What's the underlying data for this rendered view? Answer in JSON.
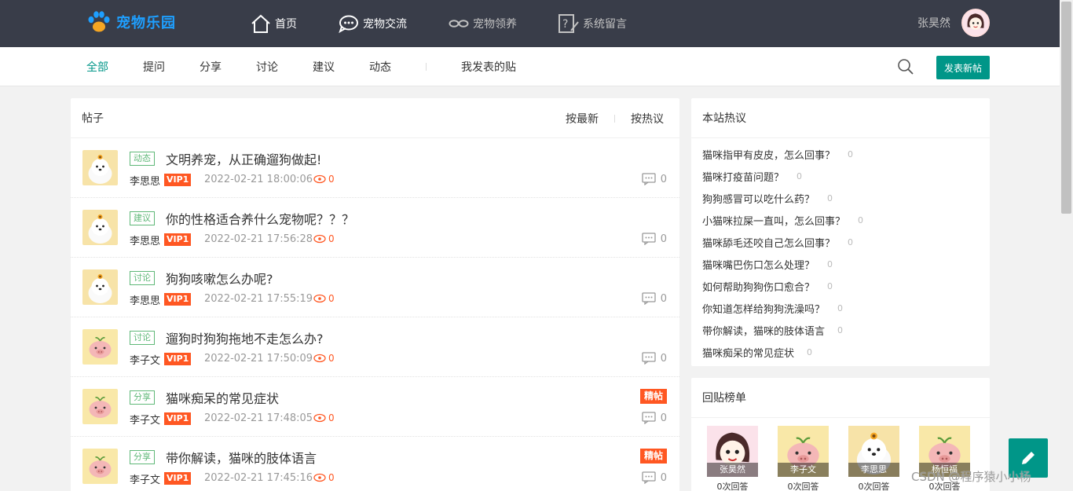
{
  "header": {
    "logo_text": "宠物乐园",
    "nav": [
      {
        "label": "首页",
        "icon": "home-icon"
      },
      {
        "label": "宠物交流",
        "icon": "chat-icon"
      },
      {
        "label": "宠物领养",
        "icon": "link-icon"
      },
      {
        "label": "系统留言",
        "icon": "message-icon"
      }
    ],
    "username": "张昊然"
  },
  "subnav": {
    "tabs": [
      "全部",
      "提问",
      "分享",
      "讨论",
      "建议",
      "动态"
    ],
    "my_posts": "我发表的贴",
    "post_button": "发表新帖"
  },
  "main": {
    "title": "帖子",
    "sort_latest": "按最新",
    "sort_hot": "按热议",
    "posts": [
      {
        "tag": "动态",
        "title": "文明养宠，从正确遛狗做起!",
        "author": "李思思",
        "vip": "VIP1",
        "time": "2022-02-21 18:00:06",
        "views": "0",
        "replies": "0",
        "badge": "",
        "avatar": "dog"
      },
      {
        "tag": "建议",
        "title": "你的性格适合养什么宠物呢？？？",
        "author": "李思思",
        "vip": "VIP1",
        "time": "2022-02-21 17:56:28",
        "views": "0",
        "replies": "0",
        "badge": "",
        "avatar": "dog"
      },
      {
        "tag": "讨论",
        "title": "狗狗咳嗽怎么办呢?",
        "author": "李思思",
        "vip": "VIP1",
        "time": "2022-02-21 17:55:19",
        "views": "0",
        "replies": "0",
        "badge": "",
        "avatar": "dog"
      },
      {
        "tag": "讨论",
        "title": "遛狗时狗狗拖地不走怎么办?",
        "author": "李子文",
        "vip": "VIP1",
        "time": "2022-02-21 17:50:09",
        "views": "0",
        "replies": "0",
        "badge": "",
        "avatar": "pig"
      },
      {
        "tag": "分享",
        "title": "猫咪痴呆的常见症状",
        "author": "李子文",
        "vip": "VIP1",
        "time": "2022-02-21 17:48:05",
        "views": "0",
        "replies": "0",
        "badge": "精帖",
        "avatar": "pig"
      },
      {
        "tag": "分享",
        "title": "带你解读，猫咪的肢体语言",
        "author": "李子文",
        "vip": "VIP1",
        "time": "2022-02-21 17:45:16",
        "views": "0",
        "replies": "0",
        "badge": "精帖",
        "avatar": "pig"
      }
    ]
  },
  "hot": {
    "title": "本站热议",
    "items": [
      {
        "text": "猫咪指甲有皮皮，怎么回事？",
        "count": "0"
      },
      {
        "text": "猫咪打疫苗问题？",
        "count": "0"
      },
      {
        "text": "狗狗感冒可以吃什么药？",
        "count": "0"
      },
      {
        "text": "小猫咪拉屎一直叫，怎么回事？",
        "count": "0"
      },
      {
        "text": "猫咪舔毛还咬自己怎么回事？",
        "count": "0"
      },
      {
        "text": "猫咪嘴巴伤口怎么处理？",
        "count": "0"
      },
      {
        "text": "如何帮助狗狗伤口愈合？",
        "count": "0"
      },
      {
        "text": "你知道怎样给狗狗洗澡吗？",
        "count": "0"
      },
      {
        "text": "带你解读，猫咪的肢体语言",
        "count": "0"
      },
      {
        "text": "猫咪痴呆的常见症状",
        "count": "0"
      }
    ]
  },
  "ranking": {
    "title": "回贴榜单",
    "users": [
      {
        "name": "张昊然",
        "count": "0次回答",
        "avatar": "girl"
      },
      {
        "name": "李子文",
        "count": "0次回答",
        "avatar": "pig"
      },
      {
        "name": "李思思",
        "count": "0次回答",
        "avatar": "dog"
      },
      {
        "name": "杨恒福",
        "count": "0次回答",
        "avatar": "pig"
      }
    ]
  },
  "watermark": "CSDN @程序猿小小杨",
  "colors": {
    "accent": "#009688",
    "vip": "#ff5722",
    "topbar": "#393d49",
    "tag": "#5fb878",
    "logo": "#1e9fff"
  }
}
